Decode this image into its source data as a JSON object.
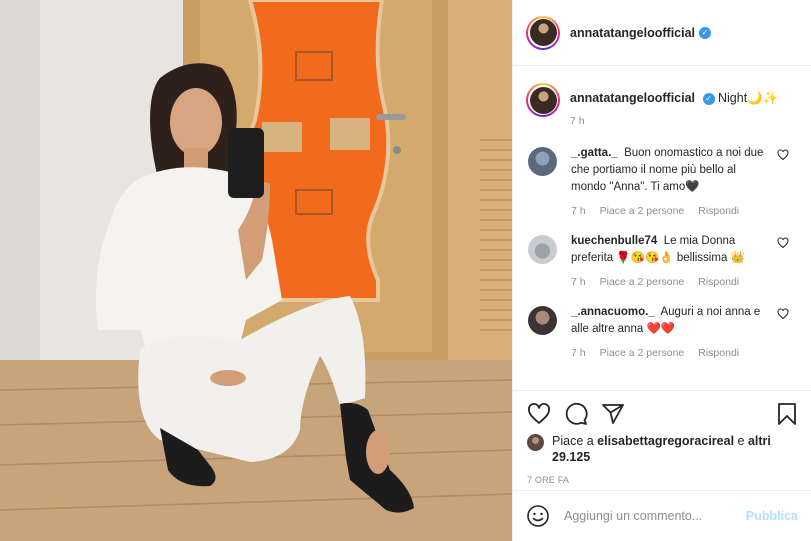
{
  "post": {
    "username": "annatatangeloofficial",
    "verified_icon": "verified-badge-icon",
    "accent_color": "#3897f0"
  },
  "caption": {
    "username": "annatatangeloofficial",
    "text": "Night🌙✨",
    "time": "7 h"
  },
  "comments": [
    {
      "username": "_.gatta._",
      "text": "Buon onomastico a noi due che portiamo il nome più bello al mondo \"Anna\". Ti amo🖤",
      "time": "7 h",
      "likes": "Piace a 2 persone",
      "reply": "Rispondi"
    },
    {
      "username": "kuechenbulle74",
      "text": "Le mia Donna preferita 🌹😘😘👌 bellissima 👑",
      "time": "7 h",
      "likes": "Piace a 2 persone",
      "reply": "Rispondi"
    },
    {
      "username": "_.annacuomo._",
      "text": "Auguri a noi anna e alle altre anna ❤️❤️",
      "time": "7 h",
      "likes": "Piace a 2 persone",
      "reply": "Rispondi"
    }
  ],
  "actions": {
    "like_prefix": "Piace a ",
    "like_user": "elisabettagregoracireal",
    "like_mid": " e ",
    "like_count": "altri 29.125",
    "timestamp": "7 ORE FA"
  },
  "add_comment": {
    "placeholder": "Aggiungi un commento...",
    "publish": "Pubblica"
  }
}
